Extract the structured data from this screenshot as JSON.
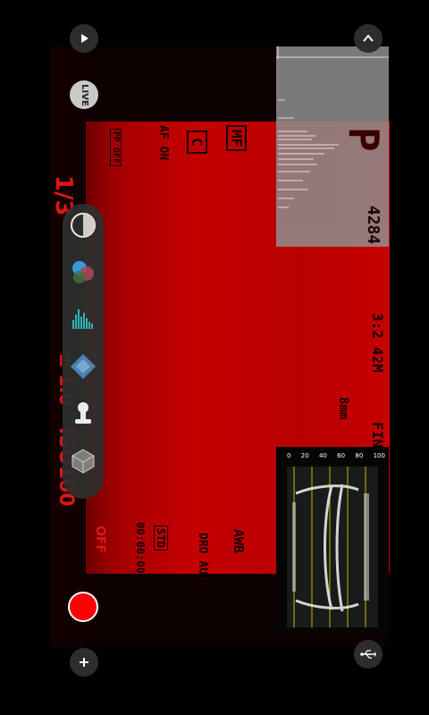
{
  "controls": {
    "live_label": "LIVE",
    "play_icon": "play-icon",
    "collapse_icon": "chevron-up-icon",
    "add_icon": "plus-icon",
    "usb_icon": "usb-icon",
    "record_icon": "record-icon"
  },
  "osd": {
    "shutter": "1/3",
    "mode": "P",
    "shots_left": "4284",
    "aspect": "3:2",
    "image_size": "42M",
    "focal": "8mm",
    "quality": "FINE",
    "focus_mode": "MF",
    "drive": "C",
    "af_on": "AF ON",
    "pp": "PP OFF",
    "wb": "AWB",
    "dro": "DRO AUTO",
    "std": "STD",
    "timecode": "00:00:00",
    "iso": "ISO100",
    "exposure": "± 1.0",
    "steady": "OFF"
  },
  "toolbar": {
    "items": [
      {
        "name": "exposure-half-circle-icon"
      },
      {
        "name": "color-balls-icon"
      },
      {
        "name": "histogram-bars-icon"
      },
      {
        "name": "diamond-icon"
      },
      {
        "name": "person-icon"
      },
      {
        "name": "cube-icon"
      }
    ]
  },
  "waveform": {
    "scale": [
      "0",
      "20",
      "40",
      "60",
      "80",
      "100"
    ]
  },
  "colors": {
    "accent_red": "#e01515",
    "record_red": "#ff0000"
  }
}
